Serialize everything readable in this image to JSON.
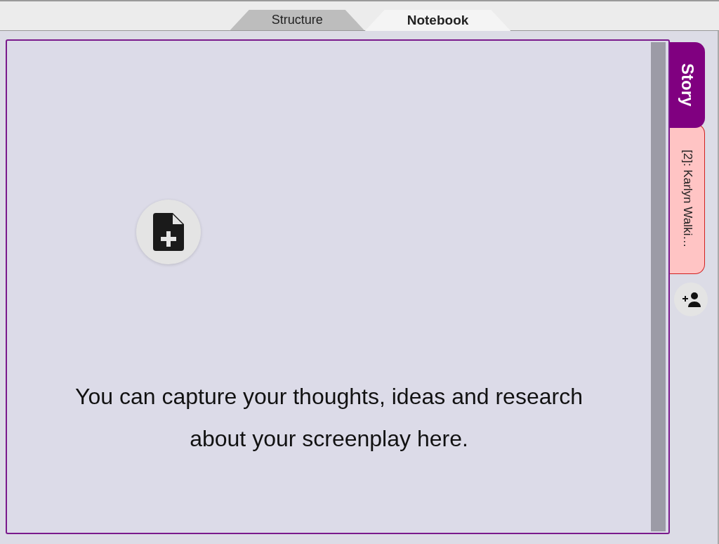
{
  "tabs": [
    {
      "label": "Structure",
      "selected": false
    },
    {
      "label": "Notebook",
      "selected": true
    }
  ],
  "notebook": {
    "message": "You can capture your thoughts, ideas and research about your screenplay here."
  },
  "side_tabs": [
    {
      "label": "Story",
      "selected": true,
      "color": "#800080"
    },
    {
      "label": "[2]: Karlyn Walki…",
      "selected": false,
      "color": "#ffc4c4"
    }
  ]
}
